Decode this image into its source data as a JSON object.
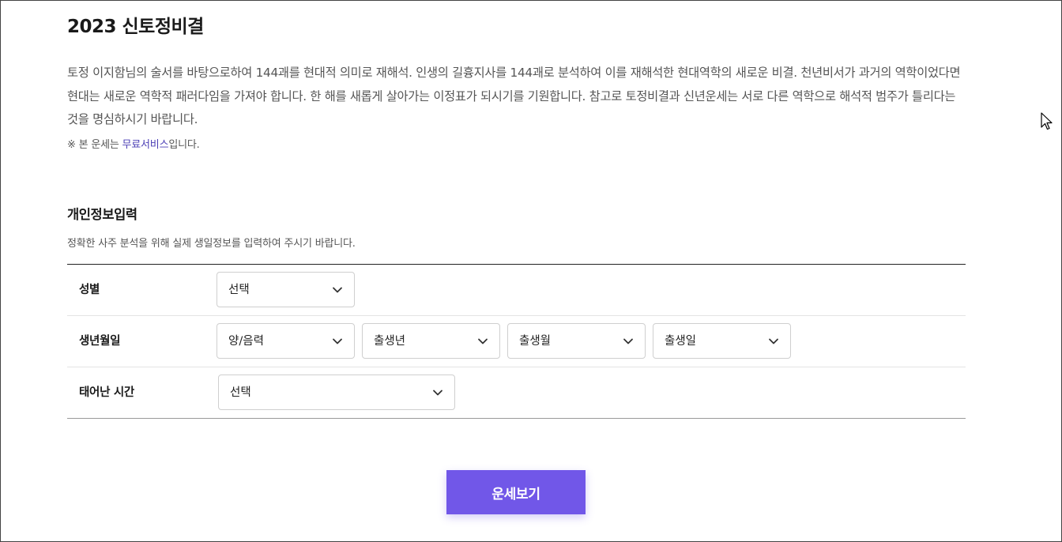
{
  "page": {
    "title": "2023 신토정비결",
    "description": "토정 이지함님의 술서를 바탕으로하여 144괘를 현대적 의미로 재해석. 인생의 길흉지사를 144괘로 분석하여 이를 재해석한 현대역학의 새로운 비결. 천년비서가 과거의 역학이었다면 현대는 새로운 역학적 패러다임을 가져야 합니다. 한 해를 새롭게 살아가는 이정표가 되시기를 기원합니다. 참고로 토정비결과 신년운세는 서로 다른 역학으로 해석적 범주가 틀리다는 것을 명심하시기 바랍니다.",
    "notice_prefix": "※ 본 운세는 ",
    "notice_link": "무료서비스",
    "notice_suffix": "입니다."
  },
  "form": {
    "section_title": "개인정보입력",
    "section_desc": "정확한 사주 분석을 위해 실제 생일정보를 입력하여 주시기 바랍니다.",
    "gender": {
      "label": "성별",
      "value": "선택"
    },
    "birth": {
      "label": "생년월일",
      "calendar": "양/음력",
      "year": "출생년",
      "month": "출생월",
      "day": "출생일"
    },
    "time": {
      "label": "태어난 시간",
      "value": "선택"
    }
  },
  "actions": {
    "submit_label": "운세보기"
  },
  "colors": {
    "accent": "#7157e8",
    "link": "#4b3fb5"
  },
  "icons": {
    "dropdown": "chevron-down-icon",
    "cursor": "mouse-pointer-icon"
  }
}
